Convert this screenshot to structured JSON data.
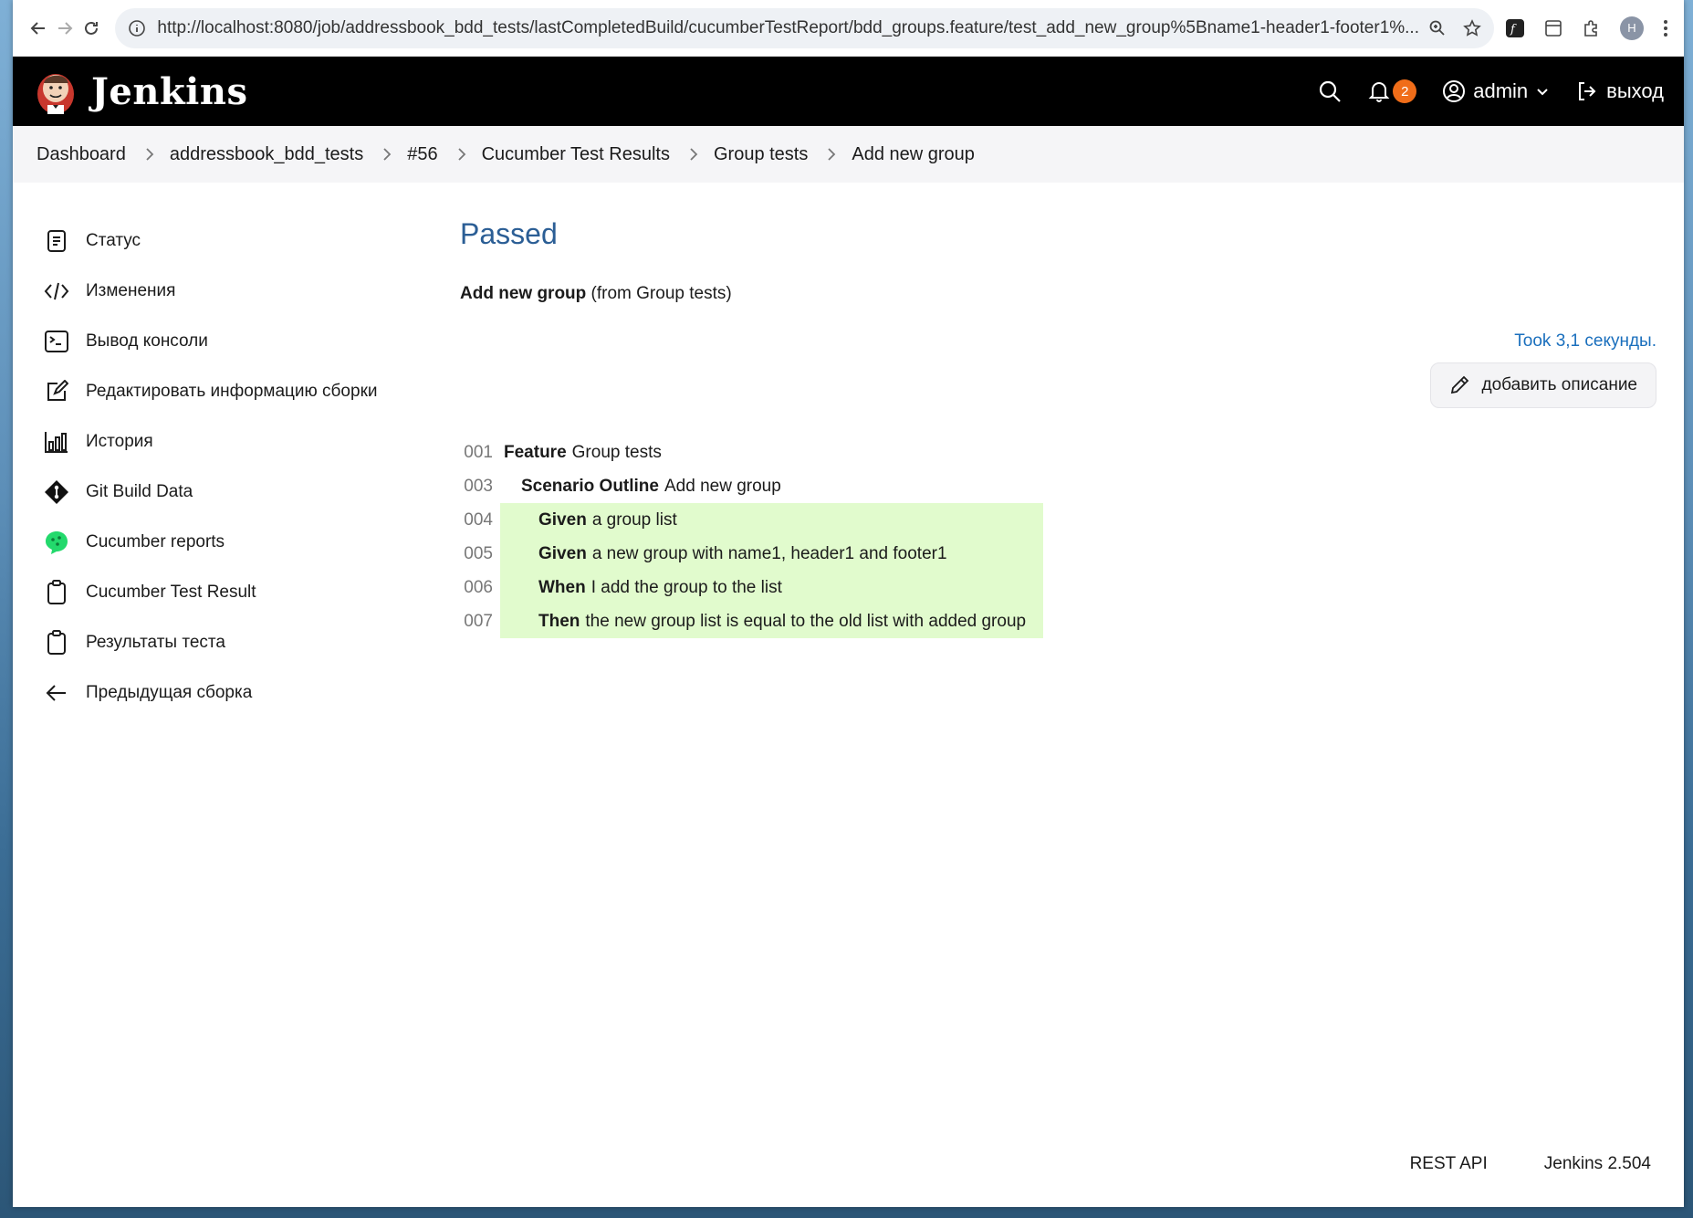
{
  "browser": {
    "url": "http://localhost:8080/job/addressbook_bdd_tests/lastCompletedBuild/cucumberTestReport/bdd_groups.feature/test_add_new_group%5Bname1-header1-footer1%...",
    "profile_initial": "H"
  },
  "header": {
    "logo_text": "Jenkins",
    "notifications_count": "2",
    "user": "admin",
    "logout": "выход"
  },
  "breadcrumbs": [
    "Dashboard",
    "addressbook_bdd_tests",
    "#56",
    "Cucumber Test Results",
    "Group tests",
    "Add new group"
  ],
  "sidebar": {
    "items": [
      {
        "label": "Статус",
        "icon": "document-icon"
      },
      {
        "label": "Изменения",
        "icon": "code-icon"
      },
      {
        "label": "Вывод консоли",
        "icon": "terminal-icon"
      },
      {
        "label": "Редактировать информацию сборки",
        "icon": "edit-icon"
      },
      {
        "label": "История",
        "icon": "chart-icon"
      },
      {
        "label": "Git Build Data",
        "icon": "git-icon"
      },
      {
        "label": "Cucumber reports",
        "icon": "cucumber-icon"
      },
      {
        "label": "Cucumber Test Result",
        "icon": "clipboard-icon"
      },
      {
        "label": "Результаты теста",
        "icon": "clipboard-icon"
      },
      {
        "label": "Предыдущая сборка",
        "icon": "arrow-left-icon"
      }
    ]
  },
  "main": {
    "title": "Passed",
    "test_name": "Add new group",
    "test_from": "(from Group tests)",
    "took": "Took 3,1 секунды.",
    "add_description": "добавить описание",
    "lines": [
      {
        "num": "001",
        "keyword": "Feature",
        "text": "Group tests",
        "indent": 0,
        "status": ""
      },
      {
        "num": "003",
        "keyword": "Scenario Outline",
        "text": "Add new group",
        "indent": 1,
        "status": ""
      },
      {
        "num": "004",
        "keyword": "Given",
        "text": "a group list",
        "indent": 2,
        "status": "passed"
      },
      {
        "num": "005",
        "keyword": "Given",
        "text": "a new group with name1, header1 and footer1",
        "indent": 2,
        "status": "passed"
      },
      {
        "num": "006",
        "keyword": "When",
        "text": "I add the group to the list",
        "indent": 2,
        "status": "passed"
      },
      {
        "num": "007",
        "keyword": "Then",
        "text": "the new group list is equal to the old list with added group",
        "indent": 2,
        "status": "passed"
      }
    ]
  },
  "footer": {
    "rest_api": "REST API",
    "version": "Jenkins 2.504"
  },
  "colors": {
    "title": "#2b5e95",
    "link": "#1a6fbd",
    "passed_bg": "#e1fbcd",
    "badge": "#f06d19"
  }
}
